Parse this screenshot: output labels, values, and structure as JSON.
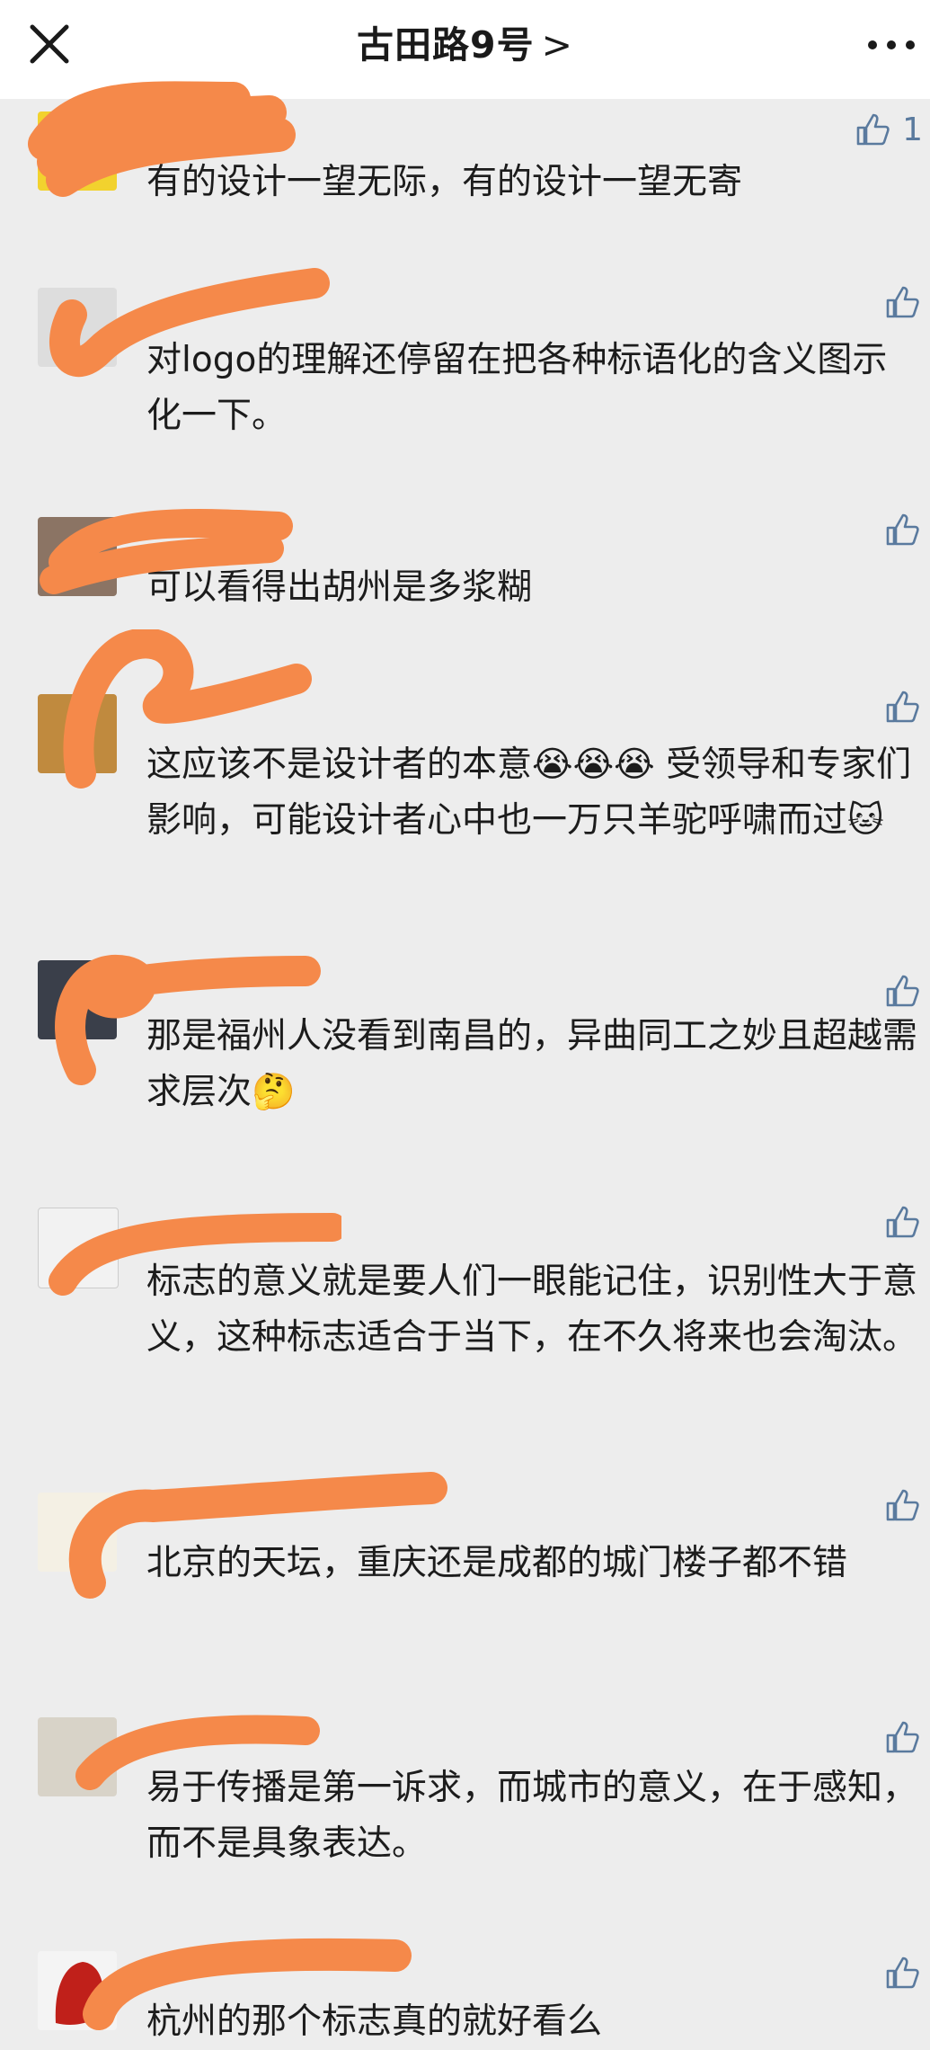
{
  "header": {
    "title": "古田路9号",
    "chevron": ">",
    "close_icon": "close-icon",
    "more_icon": "more-dots-icon"
  },
  "colors": {
    "background": "#ededed",
    "like_blue": "#5a7a9e",
    "redaction_orange": "#f5894a"
  },
  "comments": [
    {
      "text": "有的设计一望无际，有的设计一望无寄",
      "likes": "1"
    },
    {
      "text": "对logo的理解还停留在把各种标语化的含义图示化一下。",
      "likes": ""
    },
    {
      "text": "可以看得出胡州是多浆糊",
      "likes": ""
    },
    {
      "text": "这应该不是设计者的本意😭😭😭 受领导和专家们影响，可能设计者心中也一万只羊驼呼啸而过🐱",
      "likes": ""
    },
    {
      "text": "那是福州人没看到南昌的，异曲同工之妙且超越需求层次🤔",
      "likes": ""
    },
    {
      "text": "标志的意义就是要人们一眼能记住，识别性大于意义，这种标志适合于当下，在不久将来也会淘汰。",
      "likes": ""
    },
    {
      "text": "北京的天坛，重庆还是成都的城门楼子都不错",
      "likes": ""
    },
    {
      "text": "易于传播是第一诉求，而城市的意义，在于感知，而不是具象表达。",
      "likes": ""
    },
    {
      "text": "杭州的那个标志真的就好看么",
      "likes": ""
    }
  ]
}
